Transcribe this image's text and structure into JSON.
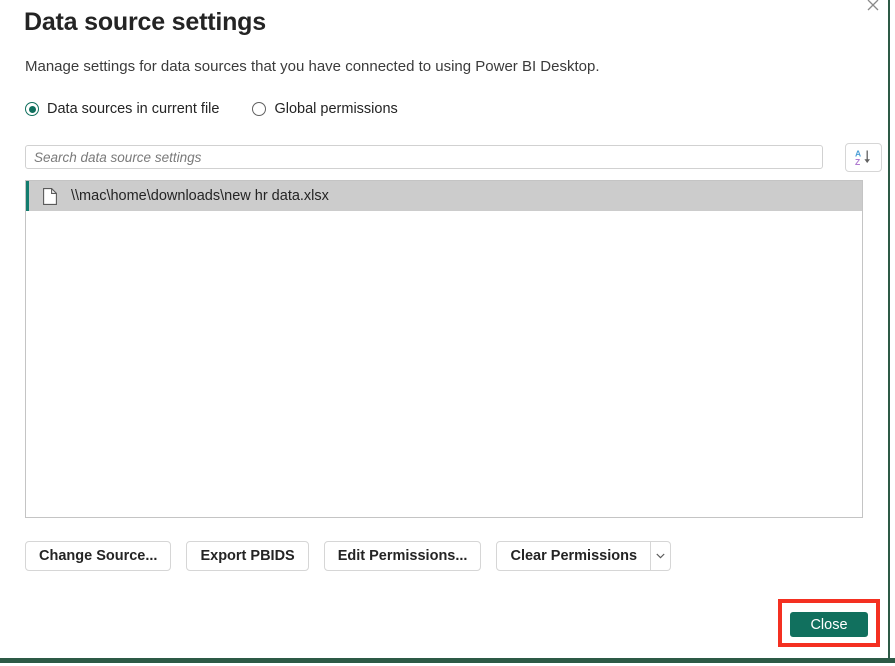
{
  "window": {
    "title": "Data source settings",
    "close_icon": "close-icon",
    "description": "Manage settings for data sources that you have connected to using Power BI Desktop."
  },
  "scope_options": [
    {
      "label": "Data sources in current file",
      "selected": true
    },
    {
      "label": "Global permissions",
      "selected": false
    }
  ],
  "search": {
    "placeholder": "Search data source settings",
    "value": "",
    "sort_icon": "sort-az-descending-icon"
  },
  "sources": [
    {
      "path": "\\\\mac\\home\\downloads\\new hr data.xlsx",
      "icon": "document-icon",
      "selected": true
    }
  ],
  "actions": {
    "change_source": "Change Source...",
    "export_pbids": "Export PBIDS",
    "edit_permissions": "Edit Permissions...",
    "clear_permissions": "Clear Permissions",
    "clear_permissions_caret_icon": "chevron-down-icon"
  },
  "footer": {
    "close_label": "Close"
  },
  "colors": {
    "accent_green": "#11705E",
    "row_accent": "#127C6E",
    "selected_row": "#CCCCCC",
    "annotation_red": "#F43021",
    "window_edge": "#2D5A46",
    "sort_a": "#4A9ED6",
    "sort_z": "#B07BD1"
  }
}
